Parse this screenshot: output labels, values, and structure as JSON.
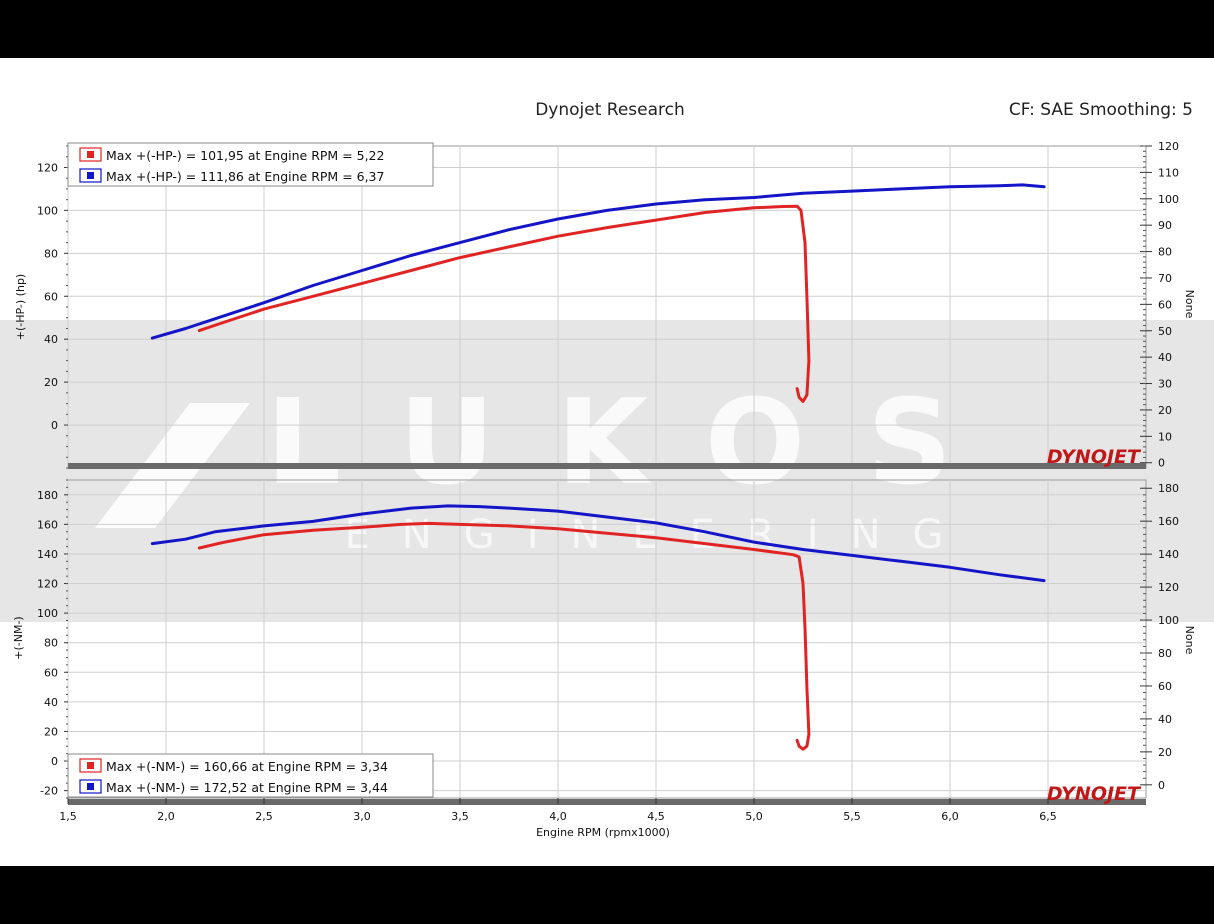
{
  "header": {
    "title": "Dynojet Research",
    "settings": "CF: SAE Smoothing: 5"
  },
  "watermark": {
    "main": "LUKOS",
    "sub": "ENGINEERING"
  },
  "brand_label": "DYNOJET",
  "colors": {
    "run1": "#e02424",
    "run2": "#1515c8",
    "watermark": "#d9d9d9",
    "grid": "#cfcfcf"
  },
  "chart_data": [
    {
      "type": "line",
      "name": "power",
      "xlabel": "Engine RPM (rpmx1000)",
      "ylabel": "+(-HP-) (hp)",
      "y2label": "None",
      "xlim": [
        1.5,
        7.0
      ],
      "ylim": [
        -20,
        130
      ],
      "xticks": [
        "1,5",
        "2,0",
        "2,5",
        "3,0",
        "3,5",
        "4,0",
        "4,5",
        "5,0",
        "5,5",
        "6,0",
        "6,5"
      ],
      "yticks": [
        "0",
        "20",
        "40",
        "60",
        "80",
        "100",
        "120"
      ],
      "y2ticks": [
        "0",
        "10",
        "20",
        "30",
        "40",
        "50",
        "60",
        "70",
        "80",
        "90",
        "100",
        "110",
        "120"
      ],
      "y2lim": [
        -2,
        120
      ],
      "legend_position": "top-left",
      "legend": [
        "Max +(-HP-) = 101,95 at Engine RPM = 5,22",
        "Max +(-HP-) = 111,86 at Engine RPM = 6,37"
      ],
      "series": [
        {
          "x": [
            2.17,
            2.3,
            2.5,
            2.75,
            3.0,
            3.25,
            3.5,
            3.75,
            4.0,
            4.25,
            4.5,
            4.75,
            5.0,
            5.15,
            5.22,
            5.24,
            5.26,
            5.27,
            5.28,
            5.27,
            5.25,
            5.23,
            5.22
          ],
          "y": [
            44,
            48,
            54,
            60,
            66,
            72,
            78,
            83,
            88,
            92,
            95.5,
            99,
            101.2,
            101.8,
            101.95,
            100,
            85,
            60,
            30,
            14,
            11,
            13,
            17
          ]
        },
        {
          "x": [
            1.93,
            2.1,
            2.3,
            2.5,
            2.75,
            3.0,
            3.25,
            3.5,
            3.75,
            4.0,
            4.25,
            4.5,
            4.75,
            5.0,
            5.25,
            5.5,
            5.75,
            6.0,
            6.25,
            6.37,
            6.48
          ],
          "y": [
            40.5,
            45,
            51,
            57,
            65,
            72,
            79,
            85,
            91,
            96,
            100,
            103,
            105,
            106,
            108,
            109,
            110,
            111,
            111.5,
            111.86,
            111
          ]
        }
      ]
    },
    {
      "type": "line",
      "name": "torque",
      "xlabel": "Engine RPM (rpmx1000)",
      "ylabel": "+(-NM-)",
      "y2label": "None",
      "xlim": [
        1.5,
        7.0
      ],
      "ylim": [
        -25,
        190
      ],
      "xticks": [
        "1,5",
        "2,0",
        "2,5",
        "3,0",
        "3,5",
        "4,0",
        "4,5",
        "5,0",
        "5,5",
        "6,0",
        "6,5"
      ],
      "yticks": [
        "-20",
        "0",
        "20",
        "40",
        "60",
        "80",
        "100",
        "120",
        "140",
        "160",
        "180"
      ],
      "y2ticks": [
        "0",
        "20",
        "40",
        "60",
        "80",
        "100",
        "120",
        "140",
        "160",
        "180"
      ],
      "y2lim": [
        -8,
        185
      ],
      "legend_position": "bottom-left",
      "legend": [
        "Max +(-NM-) = 160,66 at Engine RPM = 3,34",
        "Max +(-NM-) = 172,52 at Engine RPM = 3,44"
      ],
      "series": [
        {
          "x": [
            2.17,
            2.3,
            2.5,
            2.75,
            3.0,
            3.2,
            3.34,
            3.5,
            3.75,
            4.0,
            4.25,
            4.5,
            4.75,
            5.0,
            5.2,
            5.23,
            5.25,
            5.26,
            5.27,
            5.28,
            5.27,
            5.25,
            5.23,
            5.22
          ],
          "y": [
            144,
            148,
            153,
            156,
            158,
            160,
            160.66,
            160,
            159,
            157,
            154,
            151,
            147,
            143,
            139.5,
            138,
            120,
            90,
            50,
            18,
            10,
            8,
            10,
            14
          ]
        },
        {
          "x": [
            1.93,
            2.1,
            2.25,
            2.5,
            2.75,
            3.0,
            3.25,
            3.44,
            3.6,
            3.75,
            4.0,
            4.25,
            4.5,
            4.75,
            5.0,
            5.25,
            5.5,
            5.75,
            6.0,
            6.25,
            6.48
          ],
          "y": [
            147,
            150,
            155,
            159,
            162,
            167,
            171,
            172.52,
            172,
            171,
            169,
            165,
            161,
            155,
            148,
            143,
            139,
            135,
            131,
            126,
            122
          ]
        }
      ]
    }
  ]
}
